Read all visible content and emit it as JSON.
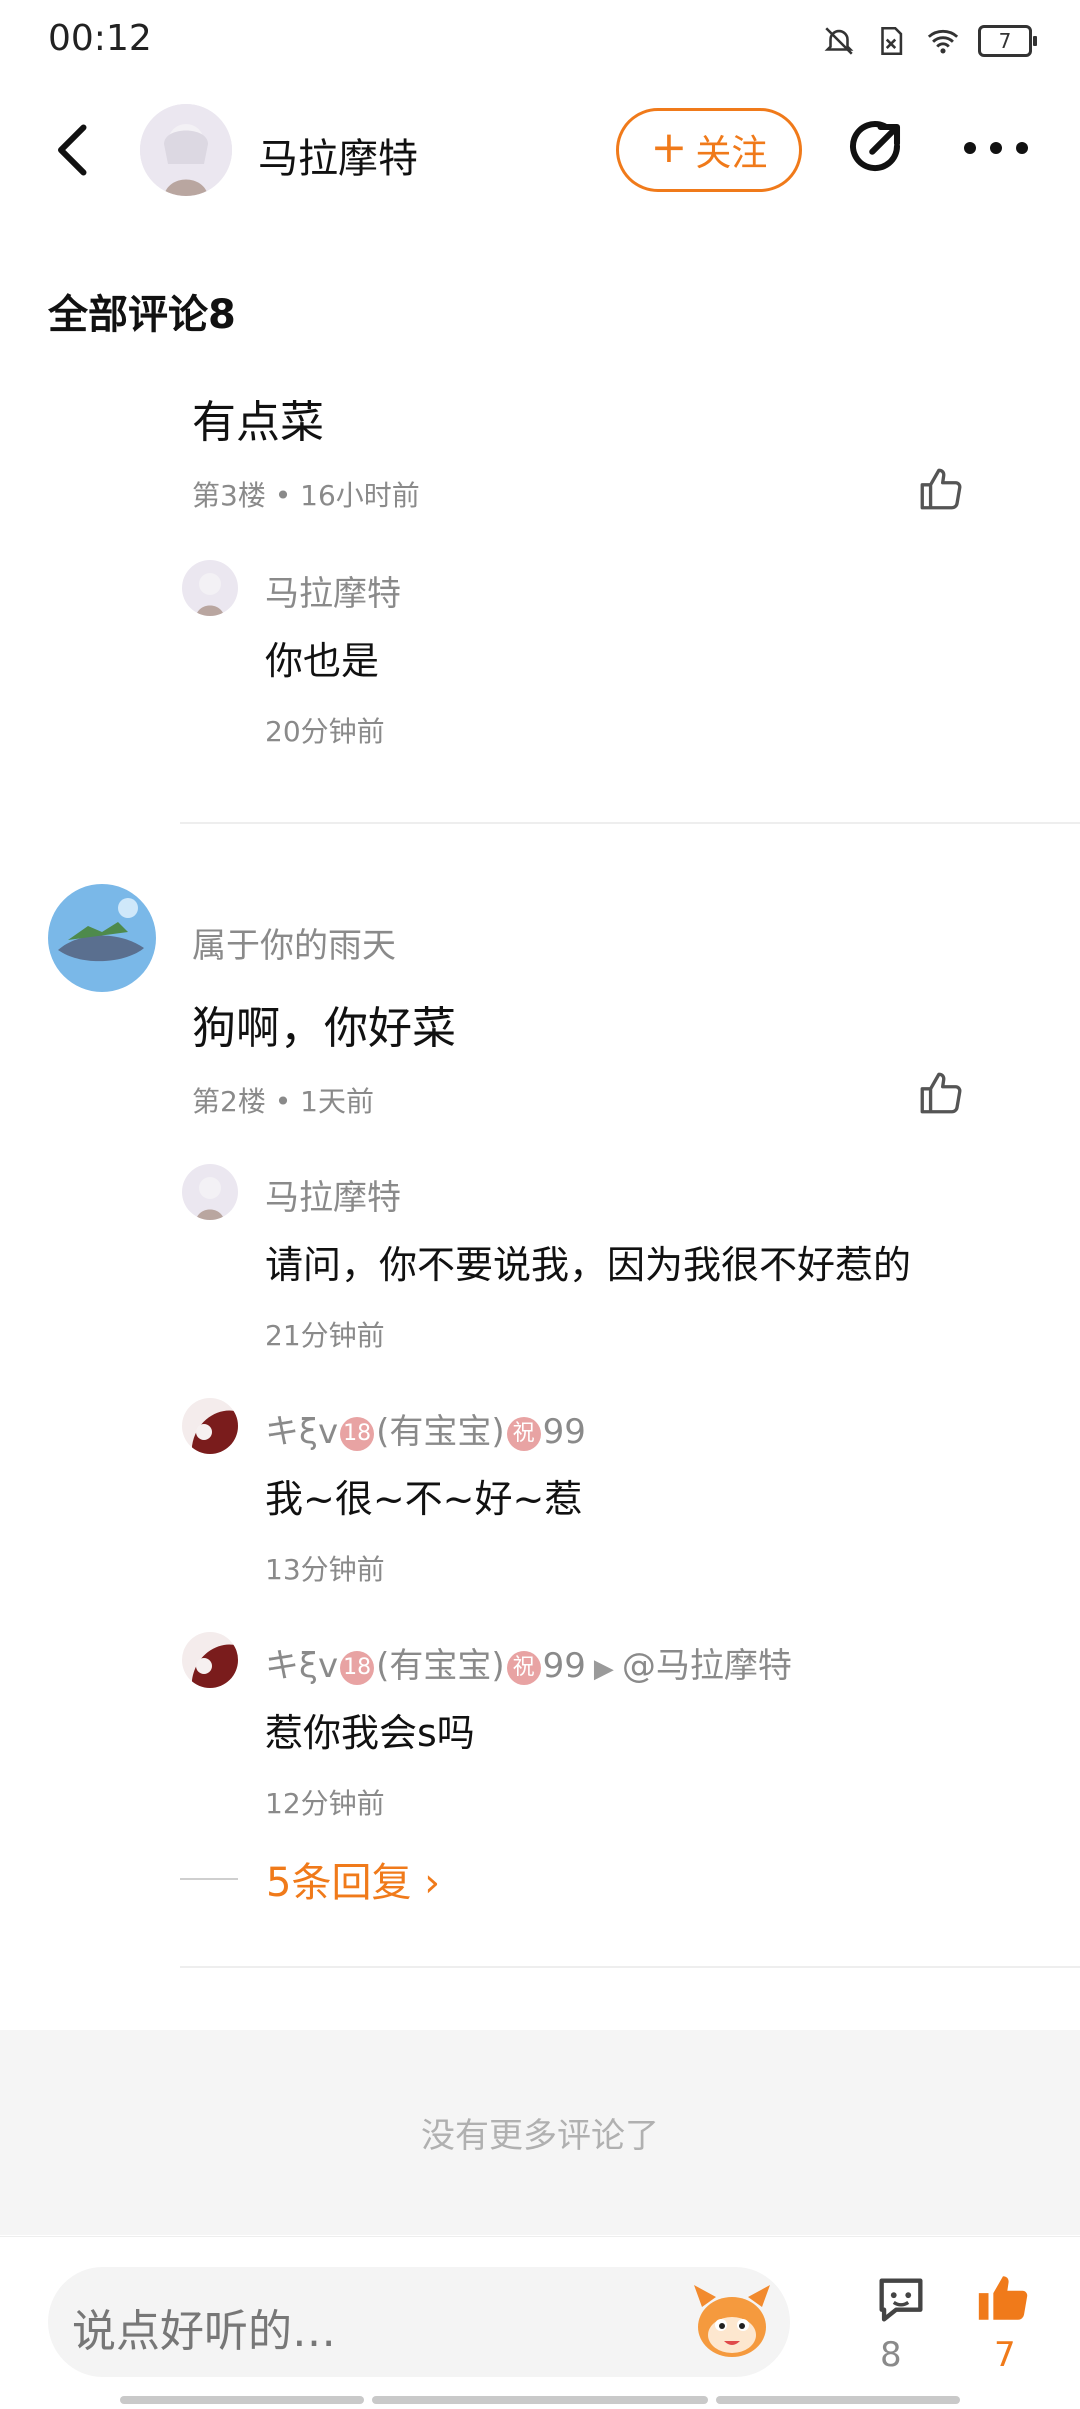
{
  "status_bar": {
    "time": "00:12",
    "battery": "7"
  },
  "header": {
    "username": "马拉摩特",
    "follow_label": "关注"
  },
  "comments_title": "全部评论8",
  "comments": [
    {
      "text": "有点菜",
      "meta": "第3楼 • 16小时前",
      "replies": [
        {
          "user": "马拉摩特",
          "text": "你也是",
          "time": "20分钟前"
        }
      ]
    },
    {
      "user": "属于你的雨天",
      "text": "狗啊，你好菜",
      "meta": "第2楼 • 1天前",
      "replies": [
        {
          "user": "马拉摩特",
          "text": "请问，你不要说我，因为我很不好惹的",
          "time": "21分钟前"
        },
        {
          "user_prefix": "キξv",
          "badge1": "18",
          "user_mid": "(有宝宝)",
          "badge2": "祝",
          "user_suffix": "99",
          "text": "我~很~不~好~惹",
          "time": "13分钟前"
        },
        {
          "user_prefix": "キξv",
          "badge1": "18",
          "user_mid": "(有宝宝)",
          "badge2": "祝",
          "user_suffix": "99",
          "reply_to": "@马拉摩特",
          "text": "惹你我会s吗",
          "time": "12分钟前"
        }
      ],
      "more_replies": "5条回复 ›"
    }
  ],
  "no_more": "没有更多评论了",
  "bottom_bar": {
    "placeholder": "说点好听的…",
    "comment_count": "8",
    "like_count": "7"
  },
  "colors": {
    "accent": "#f07a1a",
    "meta": "#8a8a8a"
  }
}
